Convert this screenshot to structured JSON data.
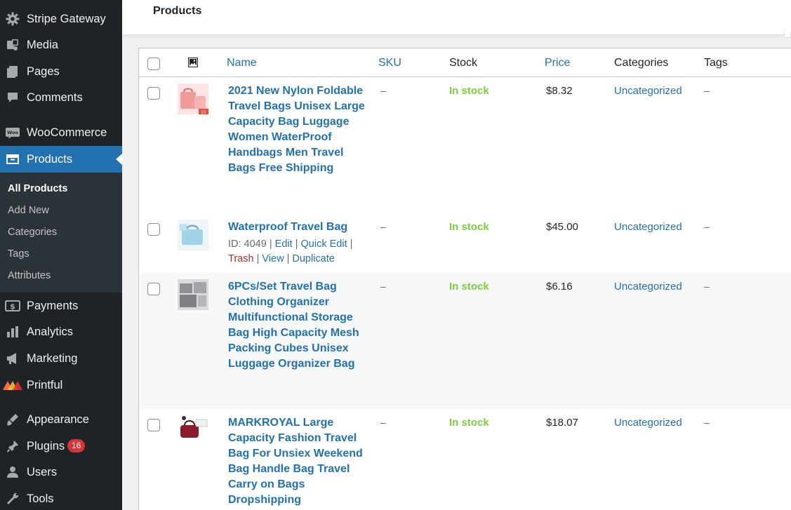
{
  "sidebar": {
    "items": [
      {
        "label": "Stripe Gateway",
        "icon": "gear-icon"
      },
      {
        "label": "Media",
        "icon": "media-icon"
      },
      {
        "label": "Pages",
        "icon": "pages-icon"
      },
      {
        "label": "Comments",
        "icon": "comments-icon"
      },
      {
        "label": "WooCommerce",
        "icon": "woocommerce-icon"
      },
      {
        "label": "Products",
        "icon": "products-icon"
      },
      {
        "label": "Payments",
        "icon": "payments-icon"
      },
      {
        "label": "Analytics",
        "icon": "analytics-icon"
      },
      {
        "label": "Marketing",
        "icon": "marketing-icon"
      },
      {
        "label": "Printful",
        "icon": "printful-icon"
      },
      {
        "label": "Appearance",
        "icon": "appearance-icon"
      },
      {
        "label": "Plugins",
        "icon": "plugins-icon",
        "badge": "16"
      },
      {
        "label": "Users",
        "icon": "users-icon"
      },
      {
        "label": "Tools",
        "icon": "tools-icon"
      }
    ],
    "submenu": [
      "All Products",
      "Add New",
      "Categories",
      "Tags",
      "Attributes"
    ]
  },
  "header": {
    "title": "Products"
  },
  "table": {
    "columns": {
      "name": "Name",
      "sku": "SKU",
      "stock": "Stock",
      "price": "Price",
      "categories": "Categories",
      "tags": "Tags"
    },
    "rows": [
      {
        "name": "2021 New Nylon Foldable Travel Bags Unisex Large Capacity Bag Luggage Women WaterProof Handbags Men Travel Bags Free Shipping",
        "sku": "–",
        "stock": "In stock",
        "price": "$8.32",
        "category": "Uncategorized",
        "tags": "–"
      },
      {
        "name": "Waterproof Travel Bag",
        "sku": "–",
        "stock": "In stock",
        "price": "$45.00",
        "category": "Uncategorized",
        "tags": "–",
        "row_actions": {
          "id": "ID: 4049",
          "edit": "Edit",
          "quick_edit": "Quick Edit",
          "trash": "Trash",
          "view": "View",
          "duplicate": "Duplicate",
          "sep": "|"
        }
      },
      {
        "name": "6PCs/Set Travel Bag Clothing Organizer Multifunctional Storage Bag High Capacity Mesh Packing Cubes Unisex Luggage Organizer Bag",
        "sku": "–",
        "stock": "In stock",
        "price": "$6.16",
        "category": "Uncategorized",
        "tags": "–"
      },
      {
        "name": "MARKROYAL Large Capacity Fashion Travel Bag For Unsiex Weekend Bag Handle Bag Travel Carry on Bags Dropshipping",
        "sku": "–",
        "stock": "In stock",
        "price": "$18.07",
        "category": "Uncategorized",
        "tags": "–"
      }
    ]
  },
  "colors": {
    "sidebar": "#1d2327",
    "accent": "#2271b1",
    "in_stock": "#7ad03a",
    "badge": "#d63638",
    "trash": "#b32d2e"
  }
}
